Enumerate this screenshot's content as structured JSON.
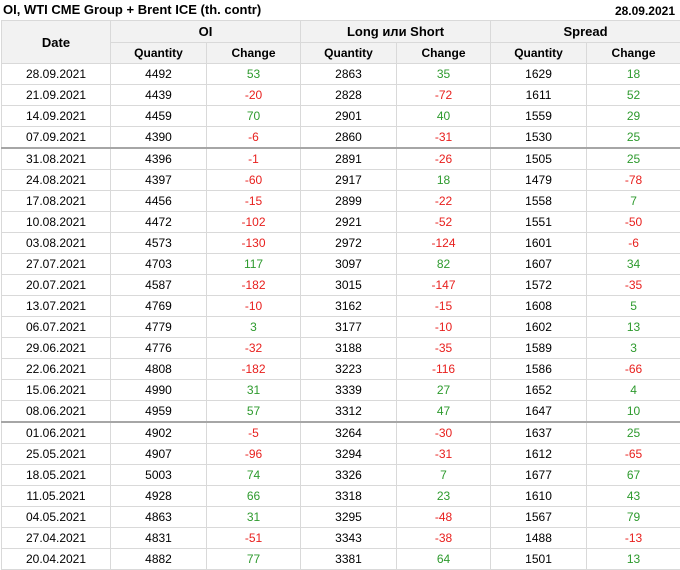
{
  "title": "OI, WTI CME Group + Brent ICE (th. contr)",
  "report_date": "28.09.2021",
  "headers": {
    "date": "Date",
    "groups": [
      "OI",
      "Long или Short",
      "Spread"
    ],
    "sub": [
      "Quantity",
      "Change",
      "Quantity",
      "Change",
      "Quantity",
      "Change"
    ]
  },
  "colors": {
    "positive": "#2e9a2e",
    "negative": "#e8201e"
  },
  "rows": [
    {
      "date": "28.09.2021",
      "oi_q": "4492",
      "oi_c": "53",
      "ls_q": "2863",
      "ls_c": "35",
      "sp_q": "1629",
      "sp_c": "18"
    },
    {
      "date": "21.09.2021",
      "oi_q": "4439",
      "oi_c": "-20",
      "ls_q": "2828",
      "ls_c": "-72",
      "sp_q": "1611",
      "sp_c": "52"
    },
    {
      "date": "14.09.2021",
      "oi_q": "4459",
      "oi_c": "70",
      "ls_q": "2901",
      "ls_c": "40",
      "sp_q": "1559",
      "sp_c": "29"
    },
    {
      "date": "07.09.2021",
      "oi_q": "4390",
      "oi_c": "-6",
      "ls_q": "2860",
      "ls_c": "-31",
      "sp_q": "1530",
      "sp_c": "25"
    },
    {
      "date": "31.08.2021",
      "oi_q": "4396",
      "oi_c": "-1",
      "ls_q": "2891",
      "ls_c": "-26",
      "sp_q": "1505",
      "sp_c": "25"
    },
    {
      "date": "24.08.2021",
      "oi_q": "4397",
      "oi_c": "-60",
      "ls_q": "2917",
      "ls_c": "18",
      "sp_q": "1479",
      "sp_c": "-78"
    },
    {
      "date": "17.08.2021",
      "oi_q": "4456",
      "oi_c": "-15",
      "ls_q": "2899",
      "ls_c": "-22",
      "sp_q": "1558",
      "sp_c": "7"
    },
    {
      "date": "10.08.2021",
      "oi_q": "4472",
      "oi_c": "-102",
      "ls_q": "2921",
      "ls_c": "-52",
      "sp_q": "1551",
      "sp_c": "-50"
    },
    {
      "date": "03.08.2021",
      "oi_q": "4573",
      "oi_c": "-130",
      "ls_q": "2972",
      "ls_c": "-124",
      "sp_q": "1601",
      "sp_c": "-6"
    },
    {
      "date": "27.07.2021",
      "oi_q": "4703",
      "oi_c": "117",
      "ls_q": "3097",
      "ls_c": "82",
      "sp_q": "1607",
      "sp_c": "34"
    },
    {
      "date": "20.07.2021",
      "oi_q": "4587",
      "oi_c": "-182",
      "ls_q": "3015",
      "ls_c": "-147",
      "sp_q": "1572",
      "sp_c": "-35"
    },
    {
      "date": "13.07.2021",
      "oi_q": "4769",
      "oi_c": "-10",
      "ls_q": "3162",
      "ls_c": "-15",
      "sp_q": "1608",
      "sp_c": "5"
    },
    {
      "date": "06.07.2021",
      "oi_q": "4779",
      "oi_c": "3",
      "ls_q": "3177",
      "ls_c": "-10",
      "sp_q": "1602",
      "sp_c": "13"
    },
    {
      "date": "29.06.2021",
      "oi_q": "4776",
      "oi_c": "-32",
      "ls_q": "3188",
      "ls_c": "-35",
      "sp_q": "1589",
      "sp_c": "3"
    },
    {
      "date": "22.06.2021",
      "oi_q": "4808",
      "oi_c": "-182",
      "ls_q": "3223",
      "ls_c": "-116",
      "sp_q": "1586",
      "sp_c": "-66"
    },
    {
      "date": "15.06.2021",
      "oi_q": "4990",
      "oi_c": "31",
      "ls_q": "3339",
      "ls_c": "27",
      "sp_q": "1652",
      "sp_c": "4"
    },
    {
      "date": "08.06.2021",
      "oi_q": "4959",
      "oi_c": "57",
      "ls_q": "3312",
      "ls_c": "47",
      "sp_q": "1647",
      "sp_c": "10"
    },
    {
      "date": "01.06.2021",
      "oi_q": "4902",
      "oi_c": "-5",
      "ls_q": "3264",
      "ls_c": "-30",
      "sp_q": "1637",
      "sp_c": "25"
    },
    {
      "date": "25.05.2021",
      "oi_q": "4907",
      "oi_c": "-96",
      "ls_q": "3294",
      "ls_c": "-31",
      "sp_q": "1612",
      "sp_c": "-65"
    },
    {
      "date": "18.05.2021",
      "oi_q": "5003",
      "oi_c": "74",
      "ls_q": "3326",
      "ls_c": "7",
      "sp_q": "1677",
      "sp_c": "67"
    },
    {
      "date": "11.05.2021",
      "oi_q": "4928",
      "oi_c": "66",
      "ls_q": "3318",
      "ls_c": "23",
      "sp_q": "1610",
      "sp_c": "43"
    },
    {
      "date": "04.05.2021",
      "oi_q": "4863",
      "oi_c": "31",
      "ls_q": "3295",
      "ls_c": "-48",
      "sp_q": "1567",
      "sp_c": "79"
    },
    {
      "date": "27.04.2021",
      "oi_q": "4831",
      "oi_c": "-51",
      "ls_q": "3343",
      "ls_c": "-38",
      "sp_q": "1488",
      "sp_c": "-13"
    },
    {
      "date": "20.04.2021",
      "oi_q": "4882",
      "oi_c": "77",
      "ls_q": "3381",
      "ls_c": "64",
      "sp_q": "1501",
      "sp_c": "13"
    }
  ]
}
